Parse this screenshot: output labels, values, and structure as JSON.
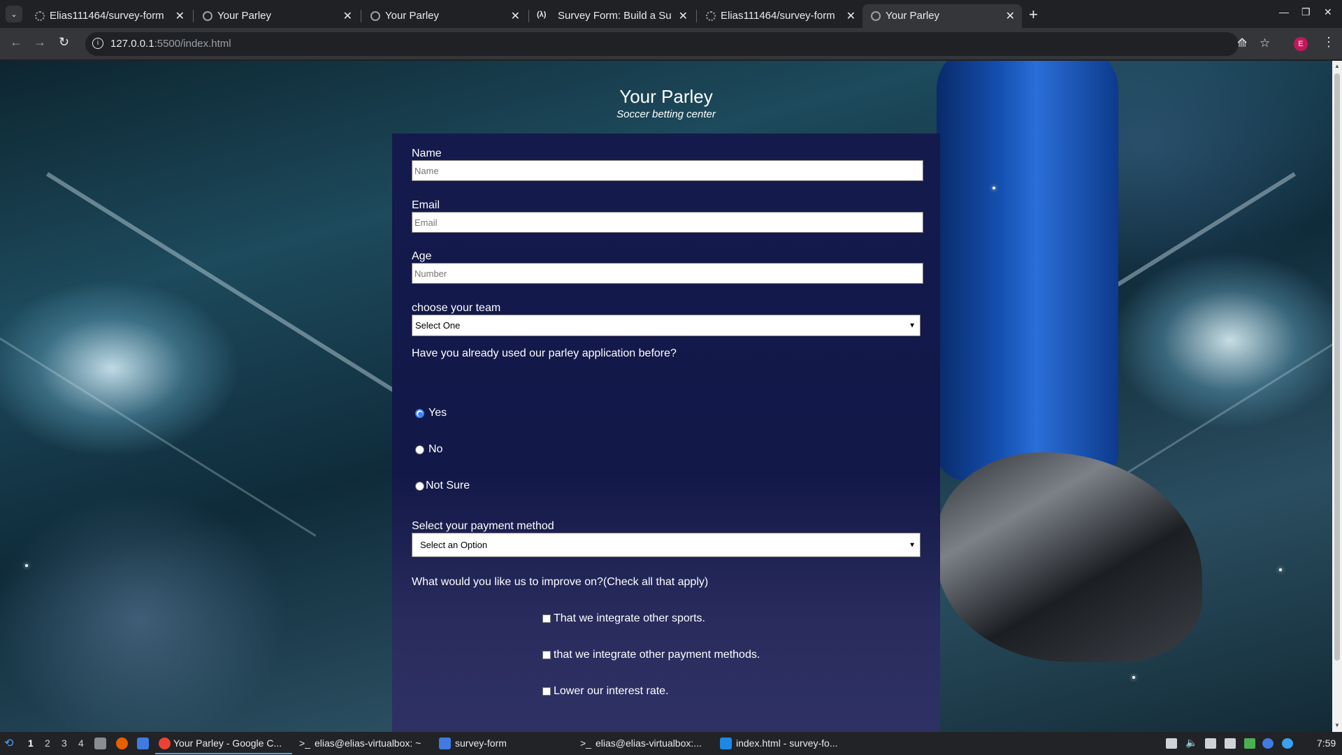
{
  "browser": {
    "tabs": [
      {
        "title": "Elias111464/survey-form",
        "icon": "github-icon",
        "active": false
      },
      {
        "title": "Your Parley",
        "icon": "globe-icon",
        "active": false
      },
      {
        "title": "Your Parley",
        "icon": "globe-icon",
        "active": false
      },
      {
        "title": "Survey Form: Build a Sur",
        "icon": "freecodecamp-icon",
        "active": false
      },
      {
        "title": "Elias111464/survey-form",
        "icon": "github-icon",
        "active": false
      },
      {
        "title": "Your Parley",
        "icon": "globe-icon",
        "active": true
      }
    ],
    "close_glyph": "✕",
    "new_tab_glyph": "+",
    "url_host": "127.0.0.1",
    "url_path": ":5500/index.html",
    "profile_initial": "E"
  },
  "page": {
    "title": "Your Parley",
    "subtitle": "Soccer betting center",
    "name_label": "Name",
    "name_placeholder": "Name",
    "email_label": "Email",
    "email_placeholder": "Email",
    "age_label": "Age",
    "age_placeholder": "Number",
    "team_label": "choose your team",
    "team_selected": "Select One",
    "used_question": "Have you already used our parley application before?",
    "radio_options": [
      "Yes",
      "No",
      "Not Sure"
    ],
    "radio_checked_index": 0,
    "payment_label": "Select your payment method",
    "payment_selected": "Select an Option",
    "improve_question": "What would you like us to improve on?(Check all that apply)",
    "checkbox_options": [
      "That we integrate other sports.",
      "that we integrate other payment methods.",
      "Lower our interest rate."
    ]
  },
  "taskbar": {
    "workspaces": [
      "1",
      "2",
      "3",
      "4"
    ],
    "active_workspace": "1",
    "windows": [
      "Your Parley - Google C...",
      "elias@elias-virtualbox: ~",
      "survey-form",
      "elias@elias-virtualbox:...",
      "index.html - survey-fo..."
    ],
    "clock": "7:59"
  },
  "colors": {
    "form_panel": "#141a4c",
    "radio_accent": "#3b82f6",
    "profile_bg": "#c2185b",
    "browser_dark": "#202124"
  }
}
